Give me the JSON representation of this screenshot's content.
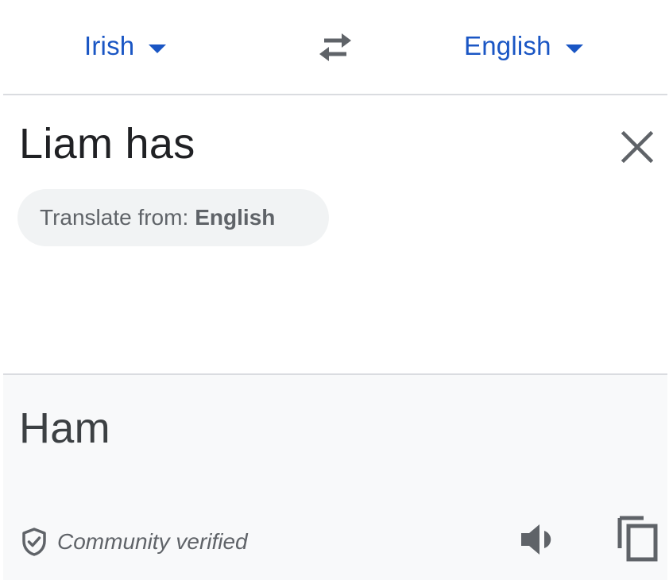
{
  "language_bar": {
    "source_language": "Irish",
    "target_language": "English",
    "swap_icon": "swap-horiz-icon"
  },
  "source": {
    "text": "Liam has",
    "clear_icon": "close-icon",
    "suggestion_prefix": "Translate from:",
    "suggestion_language": "English"
  },
  "result": {
    "text": "Ham",
    "verified_label": "Community verified",
    "verified_icon": "shield-check-icon",
    "speaker_icon": "volume-icon",
    "copy_icon": "copy-icon"
  },
  "colors": {
    "accent": "#1a56c4",
    "divider": "#dadce0",
    "result_bg": "#f8f9fa",
    "chip_bg": "#f1f3f4"
  }
}
